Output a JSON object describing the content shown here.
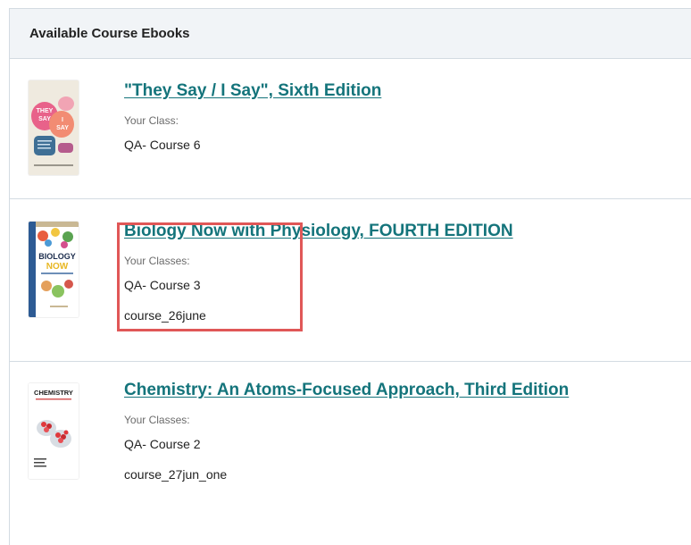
{
  "panel": {
    "title": "Available Course Ebooks"
  },
  "books": [
    {
      "title": "\"They Say / I Say\", Sixth Edition",
      "classes_label": "Your Class:",
      "classes": [
        "QA- Course 6"
      ],
      "cover_text": [
        "THEY",
        "SAY",
        "I",
        "SAY"
      ]
    },
    {
      "title": "Biology Now with Physiology, FOURTH EDITION",
      "classes_label": "Your Classes:",
      "classes": [
        "QA- Course 3",
        "course_26june"
      ],
      "cover_text": [
        "BIOLOGY",
        "NOW"
      ]
    },
    {
      "title": "Chemistry: An Atoms-Focused Approach, Third Edition",
      "classes_label": "Your Classes:",
      "classes": [
        "QA- Course 2",
        "course_27jun_one"
      ],
      "cover_text": [
        "CHEMISTRY"
      ]
    }
  ],
  "colors": {
    "link": "#14747b",
    "header_bg": "#f1f4f7",
    "border": "#d3dbe2",
    "highlight": "#e05757"
  }
}
